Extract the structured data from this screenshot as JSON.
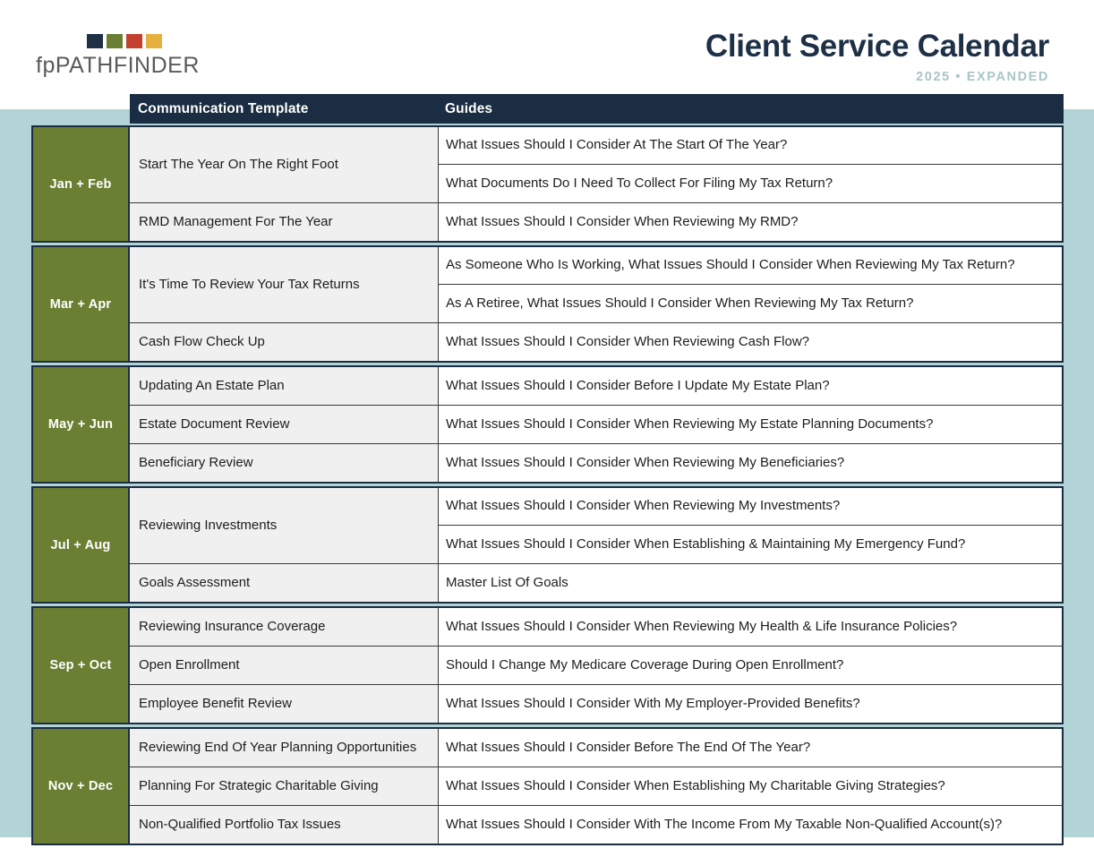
{
  "brand": {
    "wordmark_prefix": "fp",
    "wordmark_main": "PATHFINDER",
    "swatch_colors": [
      "#1e3046",
      "#6b7f33",
      "#c4412f",
      "#e4b03e"
    ]
  },
  "header": {
    "title": "Client Service Calendar",
    "subtitle": "2025 • EXPANDED"
  },
  "colors": {
    "navy": "#1b2d42",
    "olive": "#6b7f33",
    "teal_background": "#b2d4d6",
    "subtitle_gray": "#a9c6c4",
    "template_cell_gray": "#f0f0f0"
  },
  "table": {
    "columns": {
      "month": "",
      "template": "Communication Template",
      "guides": "Guides"
    },
    "sections": [
      {
        "month": "Jan + Feb",
        "rows": [
          {
            "template": "Start The Year On The Right Foot",
            "guides": [
              "What Issues Should I Consider At The Start Of The Year?",
              "What Documents Do I Need To Collect For Filing My Tax Return?"
            ]
          },
          {
            "template": "RMD Management For The Year",
            "guides": [
              "What Issues Should I Consider When Reviewing My RMD?"
            ]
          }
        ]
      },
      {
        "month": "Mar + Apr",
        "rows": [
          {
            "template": "It's Time To Review Your Tax Returns",
            "guides": [
              "As Someone Who Is Working, What Issues Should I Consider When Reviewing My Tax Return?",
              "As A Retiree, What Issues Should I Consider When Reviewing My Tax Return?"
            ]
          },
          {
            "template": "Cash Flow Check Up",
            "guides": [
              "What Issues Should I Consider When Reviewing Cash Flow?"
            ]
          }
        ]
      },
      {
        "month": "May + Jun",
        "rows": [
          {
            "template": "Updating An Estate Plan",
            "guides": [
              "What Issues Should I Consider Before I Update My Estate Plan?"
            ]
          },
          {
            "template": "Estate Document Review",
            "guides": [
              "What Issues Should I Consider When Reviewing My Estate Planning Documents?"
            ]
          },
          {
            "template": "Beneficiary Review",
            "guides": [
              "What Issues Should I Consider When Reviewing My Beneficiaries?"
            ]
          }
        ]
      },
      {
        "month": "Jul + Aug",
        "rows": [
          {
            "template": "Reviewing Investments",
            "guides": [
              "What Issues Should I Consider When Reviewing My Investments?",
              "What Issues Should I Consider When Establishing & Maintaining My Emergency Fund?"
            ]
          },
          {
            "template": "Goals Assessment",
            "guides": [
              "Master List Of Goals"
            ]
          }
        ]
      },
      {
        "month": "Sep + Oct",
        "rows": [
          {
            "template": "Reviewing Insurance Coverage",
            "guides": [
              "What Issues Should I Consider When Reviewing My Health & Life Insurance Policies?"
            ]
          },
          {
            "template": "Open Enrollment",
            "guides": [
              "Should I Change My Medicare Coverage During Open Enrollment?"
            ]
          },
          {
            "template": "Employee Benefit Review",
            "guides": [
              "What Issues Should I Consider With My Employer-Provided Benefits?"
            ]
          }
        ]
      },
      {
        "month": "Nov + Dec",
        "rows": [
          {
            "template": "Reviewing End Of Year Planning Opportunities",
            "guides": [
              "What Issues Should I Consider Before The End Of The Year?"
            ]
          },
          {
            "template": "Planning For Strategic Charitable Giving",
            "guides": [
              "What Issues Should I Consider When Establishing My Charitable Giving Strategies?"
            ]
          },
          {
            "template": "Non-Qualified Portfolio Tax Issues",
            "guides": [
              "What Issues Should I Consider With The Income From My Taxable Non-Qualified Account(s)?"
            ]
          }
        ]
      }
    ]
  }
}
